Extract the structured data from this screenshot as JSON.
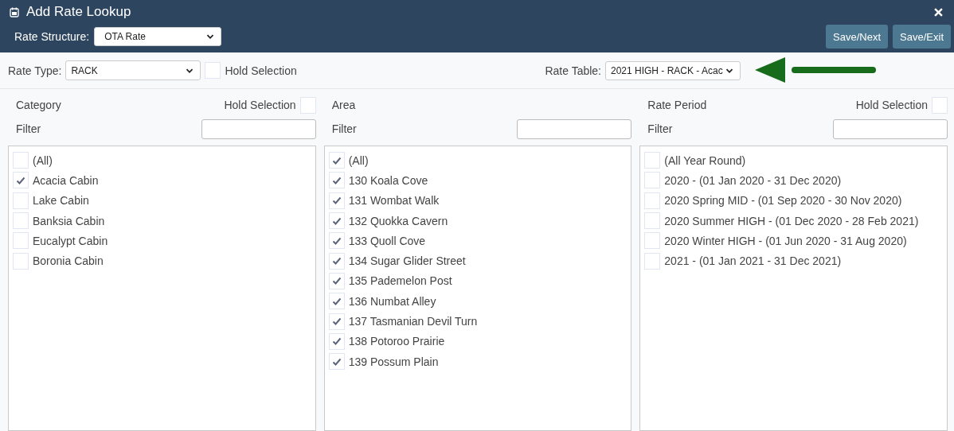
{
  "window": {
    "title": "Add Rate Lookup"
  },
  "rate_structure": {
    "label": "Rate Structure:",
    "value": "OTA Rate"
  },
  "buttons": [
    "Save/Next",
    "Save/Exit"
  ],
  "rate_type": {
    "label": "Rate Type:",
    "value": "RACK",
    "hold_selection": {
      "label": "Hold Selection",
      "checked": false
    }
  },
  "rate_table": {
    "label": "Rate Table:",
    "value": "2021 HIGH - RACK - Acac"
  },
  "panels": [
    {
      "title": "Category",
      "hold_selection": {
        "label": "Hold Selection",
        "checked": false
      },
      "filter_label": "Filter",
      "items": [
        {
          "label": "(All)",
          "checked": false
        },
        {
          "label": "Acacia Cabin",
          "checked": true
        },
        {
          "label": "Lake Cabin",
          "checked": false
        },
        {
          "label": "Banksia Cabin",
          "checked": false
        },
        {
          "label": "Eucalypt Cabin",
          "checked": false
        },
        {
          "label": "Boronia Cabin",
          "checked": false
        }
      ]
    },
    {
      "title": "Area",
      "filter_label": "Filter",
      "items": [
        {
          "label": "(All)",
          "checked": true
        },
        {
          "label": "130 Koala Cove",
          "checked": true
        },
        {
          "label": "131 Wombat Walk",
          "checked": true
        },
        {
          "label": "132 Quokka Cavern",
          "checked": true
        },
        {
          "label": "133 Quoll Cove",
          "checked": true
        },
        {
          "label": "134 Sugar Glider Street",
          "checked": true
        },
        {
          "label": "135 Pademelon Post",
          "checked": true
        },
        {
          "label": "136 Numbat Alley",
          "checked": true
        },
        {
          "label": "137 Tasmanian Devil Turn",
          "checked": true
        },
        {
          "label": "138 Potoroo Prairie",
          "checked": true
        },
        {
          "label": "139 Possum Plain",
          "checked": true
        }
      ]
    },
    {
      "title": "Rate Period",
      "hold_selection": {
        "label": "Hold Selection",
        "checked": false
      },
      "filter_label": "Filter",
      "items": [
        {
          "label": "(All Year Round)",
          "checked": false
        },
        {
          "label": "2020 - (01 Jan 2020 - 31 Dec 2020)",
          "checked": false
        },
        {
          "label": "2020 Spring MID - (01 Sep 2020 - 30 Nov 2020)",
          "checked": false
        },
        {
          "label": "2020 Summer HIGH - (01 Dec 2020 - 28 Feb 2021)",
          "checked": false
        },
        {
          "label": "2020 Winter HIGH - (01 Jun 2020 - 31 Aug 2020)",
          "checked": false
        },
        {
          "label": "2021 - (01 Jan 2021 - 31 Dec 2021)",
          "checked": false
        }
      ]
    }
  ]
}
